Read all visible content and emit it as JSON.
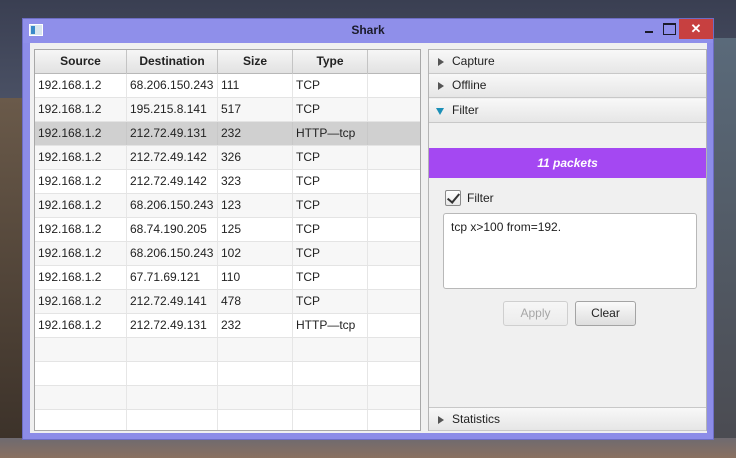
{
  "window": {
    "title": "Shark",
    "close_glyph": "✕"
  },
  "table": {
    "columns": [
      "Source",
      "Destination",
      "Size",
      "Type",
      ""
    ],
    "rows": [
      [
        "192.168.1.2",
        "68.206.150.243",
        "111",
        "TCP"
      ],
      [
        "192.168.1.2",
        "195.215.8.141",
        "517",
        "TCP"
      ],
      [
        "192.168.1.2",
        "212.72.49.131",
        "232",
        "HTTP—tcp"
      ],
      [
        "192.168.1.2",
        "212.72.49.142",
        "326",
        "TCP"
      ],
      [
        "192.168.1.2",
        "212.72.49.142",
        "323",
        "TCP"
      ],
      [
        "192.168.1.2",
        "68.206.150.243",
        "123",
        "TCP"
      ],
      [
        "192.168.1.2",
        "68.74.190.205",
        "125",
        "TCP"
      ],
      [
        "192.168.1.2",
        "68.206.150.243",
        "102",
        "TCP"
      ],
      [
        "192.168.1.2",
        "67.71.69.121",
        "110",
        "TCP"
      ],
      [
        "192.168.1.2",
        "212.72.49.141",
        "478",
        "TCP"
      ],
      [
        "192.168.1.2",
        "212.72.49.131",
        "232",
        "HTTP—tcp"
      ]
    ],
    "selected_row_index": 2,
    "empty_rows": 4
  },
  "panel": {
    "sections": {
      "capture": "Capture",
      "offline": "Offline",
      "filter": "Filter",
      "statistics": "Statistics"
    },
    "expanded_section": "Filter",
    "packet_count_label": "11 packets",
    "filter_checkbox": {
      "label": "Filter",
      "checked": true
    },
    "filter_expression": "tcp x>100 from=192.",
    "apply_button": {
      "label": "Apply",
      "enabled": false
    },
    "clear_button": {
      "label": "Clear",
      "enabled": true
    },
    "accent_color": "#a448f2"
  }
}
